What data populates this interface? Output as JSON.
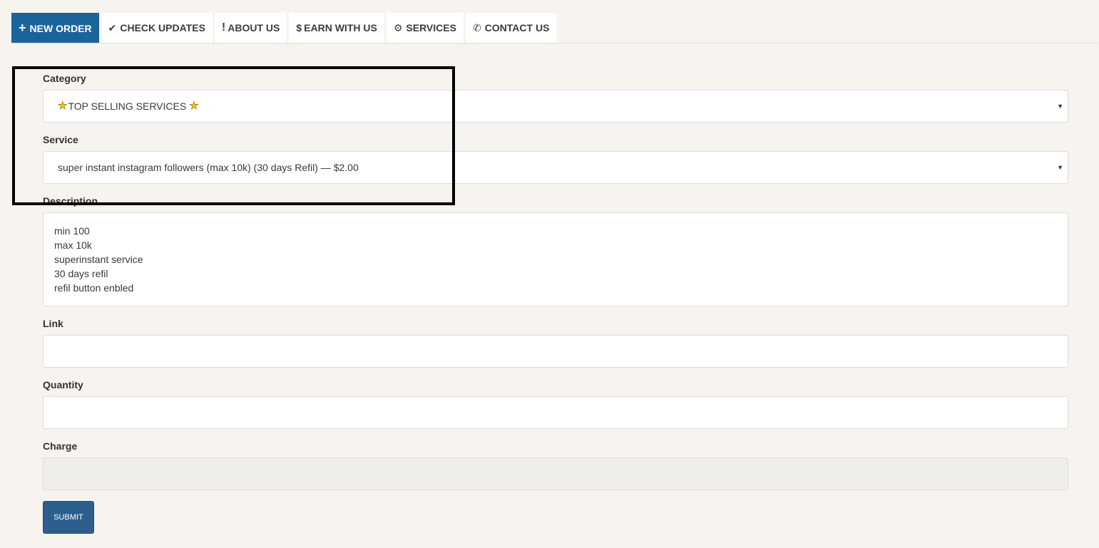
{
  "nav": {
    "tabs": [
      {
        "icon": "plus-icon",
        "glyph": "+",
        "label": "NEW ORDER",
        "active": true
      },
      {
        "icon": "check-icon",
        "glyph": "✔",
        "label": "CHECK UPDATES",
        "active": false
      },
      {
        "icon": "exclamation-icon",
        "glyph": "!",
        "label": "ABOUT US",
        "active": false
      },
      {
        "icon": "dollar-icon",
        "glyph": "$",
        "label": "EARN WITH US",
        "active": false
      },
      {
        "icon": "gear-icon",
        "glyph": "⚙",
        "label": "SERVICES",
        "active": false
      },
      {
        "icon": "phone-icon",
        "glyph": "✆",
        "label": "CONTACT US",
        "active": false
      }
    ],
    "active_color": "#1a649c"
  },
  "form": {
    "category": {
      "label": "Category",
      "value": "TOP SELLING SERVICES"
    },
    "service": {
      "label": "Service",
      "value": "super instant instagram followers (max 10k) (30 days Refil) — $2.00"
    },
    "description": {
      "label": "Description",
      "lines": [
        "min 100",
        "max 10k",
        "superinstant service",
        "30 days refil",
        "refil button enbled"
      ]
    },
    "link": {
      "label": "Link",
      "value": ""
    },
    "quantity": {
      "label": "Quantity",
      "value": ""
    },
    "charge": {
      "label": "Charge",
      "value": ""
    },
    "submit_label": "SUBMIT"
  }
}
